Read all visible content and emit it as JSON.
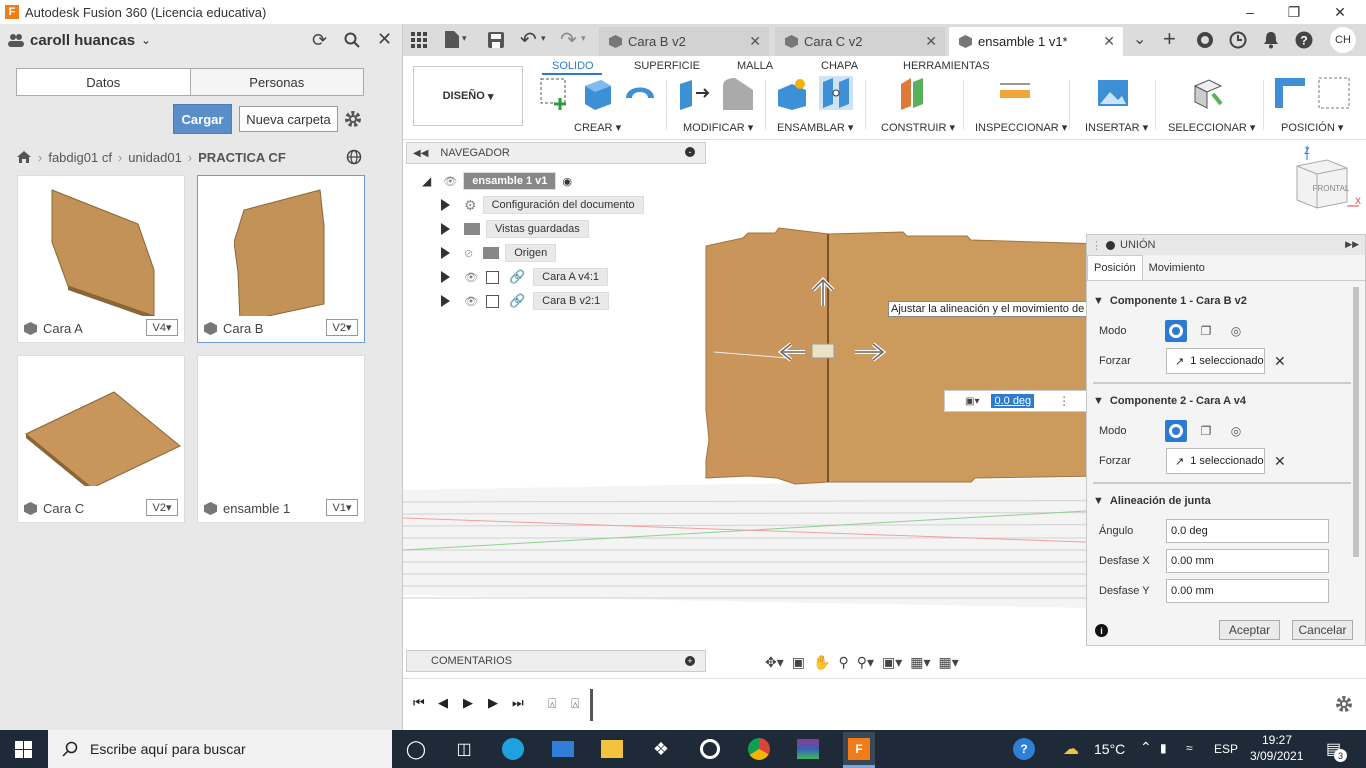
{
  "window": {
    "title": "Autodesk Fusion 360 (Licencia educativa)",
    "logo": "F"
  },
  "data_panel": {
    "user": "caroll huancas",
    "tabs": [
      "Datos",
      "Personas"
    ],
    "upload_label": "Cargar",
    "new_folder_label": "Nueva carpeta",
    "breadcrumb": [
      "fabdig01 cf",
      "unidad01",
      "PRACTICA CF"
    ],
    "files": [
      {
        "name": "Cara A",
        "version": "V4"
      },
      {
        "name": "Cara B",
        "version": "V2"
      },
      {
        "name": "Cara C",
        "version": "V2"
      },
      {
        "name": "ensamble 1",
        "version": "V1"
      }
    ]
  },
  "doc_tabs": [
    "Cara B v2",
    "Cara C v2",
    "ensamble 1 v1*"
  ],
  "user_initials": "CH",
  "toolbar": {
    "workspace": "DISEÑO",
    "tabs": [
      "SOLIDO",
      "SUPERFICIE",
      "MALLA",
      "CHAPA",
      "HERRAMIENTAS"
    ],
    "sections": [
      "CREAR",
      "MODIFICAR",
      "ENSAMBLAR",
      "CONSTRUIR",
      "INSPECCIONAR",
      "INSERTAR",
      "SELECCIONAR",
      "POSICIÓN"
    ]
  },
  "navigator": {
    "title": "NAVEGADOR",
    "root": "ensamble 1 v1",
    "items": [
      "Configuración del documento",
      "Vistas guardadas",
      "Origen",
      "Cara A v4:1",
      "Cara B v2:1"
    ]
  },
  "comments_label": "COMENTARIOS",
  "viewcube": {
    "face_label": "FRONTAL",
    "axis_labels": [
      "Z",
      "X"
    ]
  },
  "viewport": {
    "tooltip": "Ajustar la alineación y el movimiento de la unión",
    "angle_input": "0.0 deg"
  },
  "joint_panel": {
    "title": "UNIÓN",
    "tabs": [
      "Posición",
      "Movimiento"
    ],
    "component1": "Componente 1 - Cara B v2",
    "component2": "Componente 2 - Cara A v4",
    "mode_label": "Modo",
    "snap_label": "Forzar",
    "selected_text": "1 seleccionado",
    "alignment_title": "Alineación de junta",
    "angle_label": "Ángulo",
    "angle_value": "0.0 deg",
    "offset_x_label": "Desfase X",
    "offset_x_value": "0.00 mm",
    "offset_y_label": "Desfase Y",
    "offset_y_value": "0.00 mm",
    "ok_label": "Aceptar",
    "cancel_label": "Cancelar"
  },
  "taskbar": {
    "search_placeholder": "Escribe aquí para buscar",
    "temperature": "15°C",
    "language": "ESP",
    "time": "19:27",
    "date": "3/09/2021",
    "notifications": "3"
  },
  "colors": {
    "accent": "#2b7bd3",
    "wood": "#c9955a",
    "taskbar": "#1e2a38",
    "brand": "#f07c1a"
  }
}
